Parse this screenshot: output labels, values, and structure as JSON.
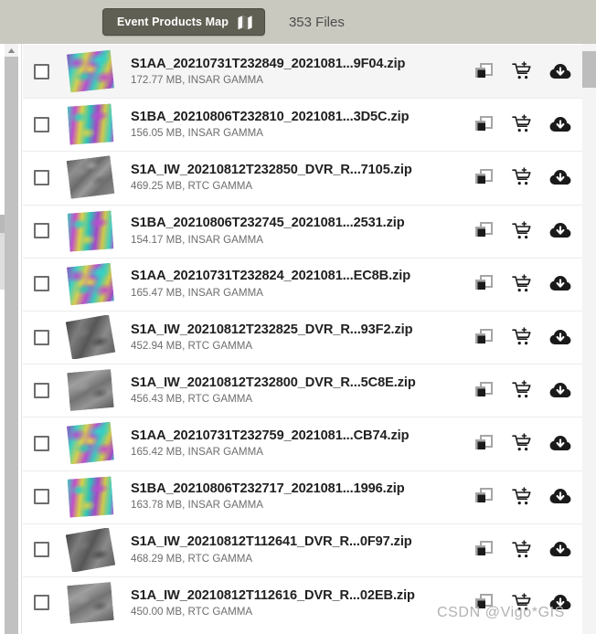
{
  "header": {
    "map_button_label": "Event Products Map",
    "map_icon": "map-icon",
    "file_count_label": "353 Files",
    "background_color": "#c9c9c0",
    "button_color": "#605f53"
  },
  "actions": {
    "copy_icon": "copy-layers-icon",
    "cart_icon": "add-to-cart-icon",
    "download_icon": "cloud-download-icon"
  },
  "scrollbars": {
    "left_up_arrow": "scroll-up-arrow-icon",
    "thumb_color": "#c1c1c1"
  },
  "files": [
    {
      "name": "S1AA_20210731T232849_2021081...9F04.zip",
      "details": "172.77 MB, INSAR GAMMA",
      "size": "172.77 MB",
      "product_type": "INSAR GAMMA",
      "thumb": "insar",
      "highlighted": true
    },
    {
      "name": "S1BA_20210806T232810_2021081...3D5C.zip",
      "details": "156.05 MB, INSAR GAMMA",
      "size": "156.05 MB",
      "product_type": "INSAR GAMMA",
      "thumb": "insar2",
      "highlighted": false
    },
    {
      "name": "S1A_IW_20210812T232850_DVR_R...7105.zip",
      "details": "469.25 MB, RTC GAMMA",
      "size": "469.25 MB",
      "product_type": "RTC GAMMA",
      "thumb": "rtc",
      "highlighted": false
    },
    {
      "name": "S1BA_20210806T232745_2021081...2531.zip",
      "details": "154.17 MB, INSAR GAMMA",
      "size": "154.17 MB",
      "product_type": "INSAR GAMMA",
      "thumb": "insar2",
      "highlighted": false
    },
    {
      "name": "S1AA_20210731T232824_2021081...EC8B.zip",
      "details": "165.47 MB, INSAR GAMMA",
      "size": "165.47 MB",
      "product_type": "INSAR GAMMA",
      "thumb": "insar",
      "highlighted": false
    },
    {
      "name": "S1A_IW_20210812T232825_DVR_R...93F2.zip",
      "details": "452.94 MB, RTC GAMMA",
      "size": "452.94 MB",
      "product_type": "RTC GAMMA",
      "thumb": "rtc2",
      "highlighted": false
    },
    {
      "name": "S1A_IW_20210812T232800_DVR_R...5C8E.zip",
      "details": "456.43 MB, RTC GAMMA",
      "size": "456.43 MB",
      "product_type": "RTC GAMMA",
      "thumb": "rtc3",
      "highlighted": false
    },
    {
      "name": "S1AA_20210731T232759_2021081...CB74.zip",
      "details": "165.42 MB, INSAR GAMMA",
      "size": "165.42 MB",
      "product_type": "INSAR GAMMA",
      "thumb": "insar",
      "highlighted": false
    },
    {
      "name": "S1BA_20210806T232717_2021081...1996.zip",
      "details": "163.78 MB, INSAR GAMMA",
      "size": "163.78 MB",
      "product_type": "INSAR GAMMA",
      "thumb": "insar2",
      "highlighted": false
    },
    {
      "name": "S1A_IW_20210812T112641_DVR_R...0F97.zip",
      "details": "468.29 MB, RTC GAMMA",
      "size": "468.29 MB",
      "product_type": "RTC GAMMA",
      "thumb": "rtc2",
      "highlighted": false
    },
    {
      "name": "S1A_IW_20210812T112616_DVR_R...02EB.zip",
      "details": "450.00 MB, RTC GAMMA",
      "size": "450.00 MB",
      "product_type": "RTC GAMMA",
      "thumb": "rtc3",
      "highlighted": false
    }
  ],
  "watermark": "CSDN @Vigo*GIS"
}
